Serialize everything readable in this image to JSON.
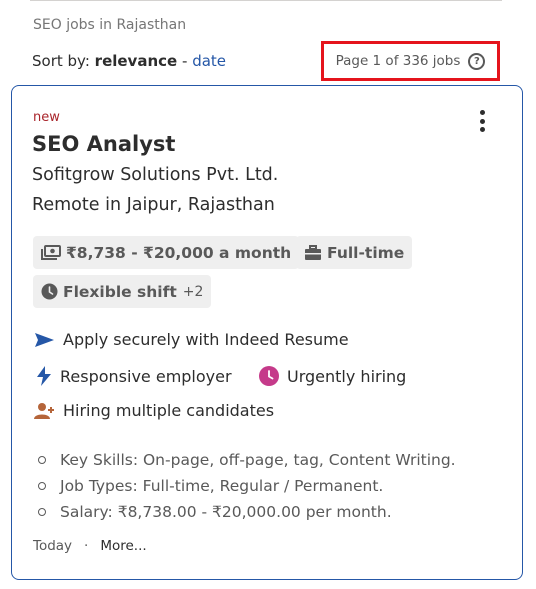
{
  "breadcrumb": "SEO jobs in Rajasthan",
  "sort": {
    "label": "Sort by:",
    "active": "relevance",
    "separator": "-",
    "alternate": "date"
  },
  "page_count": "Page 1 of 336 jobs",
  "job": {
    "new_label": "new",
    "title": "SEO Analyst",
    "company": "Sofitgrow Solutions Pvt. Ltd.",
    "location": "Remote in Jaipur, Rajasthan",
    "salary": "₹8,738 - ₹20,000 a month",
    "job_type": "Full-time",
    "shift": "Flexible shift",
    "shift_more": "+2",
    "perks": {
      "apply": "Apply securely with Indeed Resume",
      "responsive": "Responsive employer",
      "urgent": "Urgently hiring",
      "multiple": "Hiring multiple candidates"
    },
    "snippet": [
      "Key Skills: On-page, off-page, tag, Content Writing.",
      "Job Types: Full-time, Regular / Permanent.",
      "Salary: ₹8,738.00 - ₹20,000.00 per month."
    ],
    "posted": "Today",
    "footer_separator": "·",
    "more_link": "More..."
  },
  "colors": {
    "link": "#2557a7",
    "new": "#a9252b",
    "highlight_border": "#e5141c",
    "urgent": "#c53a8a",
    "responsive": "#2557a7",
    "multiple": "#b5653a"
  },
  "icons": {
    "help": "question-circle-icon",
    "more": "vertical-dots-icon",
    "salary": "money-icon",
    "job_type": "briefcase-icon",
    "shift": "clock-icon",
    "apply": "send-arrow-icon",
    "responsive": "lightning-icon",
    "urgent": "clock-icon",
    "multiple": "person-add-icon"
  }
}
